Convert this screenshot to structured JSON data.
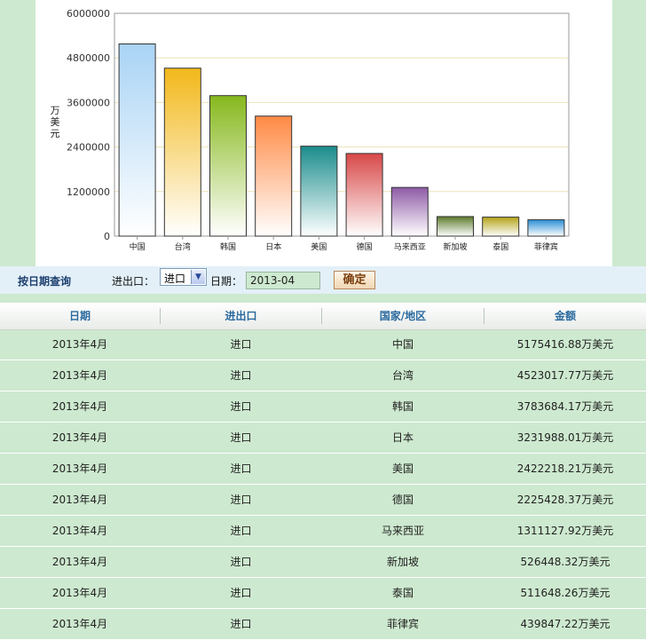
{
  "chart_data": {
    "type": "bar",
    "title": "",
    "xlabel": "",
    "ylabel": "万美元",
    "ylim": [
      0,
      6000000
    ],
    "yticks": [
      0,
      1200000,
      2400000,
      3600000,
      4800000,
      6000000
    ],
    "ytick_labels": [
      "0",
      "1200000",
      "2400000",
      "3600000",
      "4800000",
      "6000000"
    ],
    "categories": [
      "中国",
      "台湾",
      "韩国",
      "日本",
      "美国",
      "德国",
      "马来西亚",
      "新加坡",
      "泰国",
      "菲律宾"
    ],
    "values": [
      5175416.88,
      4523017.77,
      3783684.17,
      3231988.01,
      2422218.21,
      2225428.37,
      1311127.92,
      526448.32,
      511648.26,
      439847.22
    ],
    "colors": [
      "#a9d3f5",
      "#f2b81a",
      "#86b81c",
      "#ff8a45",
      "#1a8c8c",
      "#d84848",
      "#8e5aa6",
      "#5d7a2c",
      "#b4a418",
      "#2b8fd6"
    ],
    "grid": true,
    "legend": "none"
  },
  "query": {
    "title": "按日期查询",
    "io_label": "进出口：",
    "io_selected": "进口",
    "date_label": "日期：",
    "date_value": "2013-04",
    "confirm_label": "确定"
  },
  "table": {
    "headers": [
      "日期",
      "进出口",
      "国家/地区",
      "金额"
    ],
    "rows": [
      [
        "2013年4月",
        "进口",
        "中国",
        "5175416.88万美元"
      ],
      [
        "2013年4月",
        "进口",
        "台湾",
        "4523017.77万美元"
      ],
      [
        "2013年4月",
        "进口",
        "韩国",
        "3783684.17万美元"
      ],
      [
        "2013年4月",
        "进口",
        "日本",
        "3231988.01万美元"
      ],
      [
        "2013年4月",
        "进口",
        "美国",
        "2422218.21万美元"
      ],
      [
        "2013年4月",
        "进口",
        "德国",
        "2225428.37万美元"
      ],
      [
        "2013年4月",
        "进口",
        "马来西亚",
        "1311127.92万美元"
      ],
      [
        "2013年4月",
        "进口",
        "新加坡",
        "526448.32万美元"
      ],
      [
        "2013年4月",
        "进口",
        "泰国",
        "511648.26万美元"
      ],
      [
        "2013年4月",
        "进口",
        "菲律宾",
        "439847.22万美元"
      ]
    ]
  }
}
